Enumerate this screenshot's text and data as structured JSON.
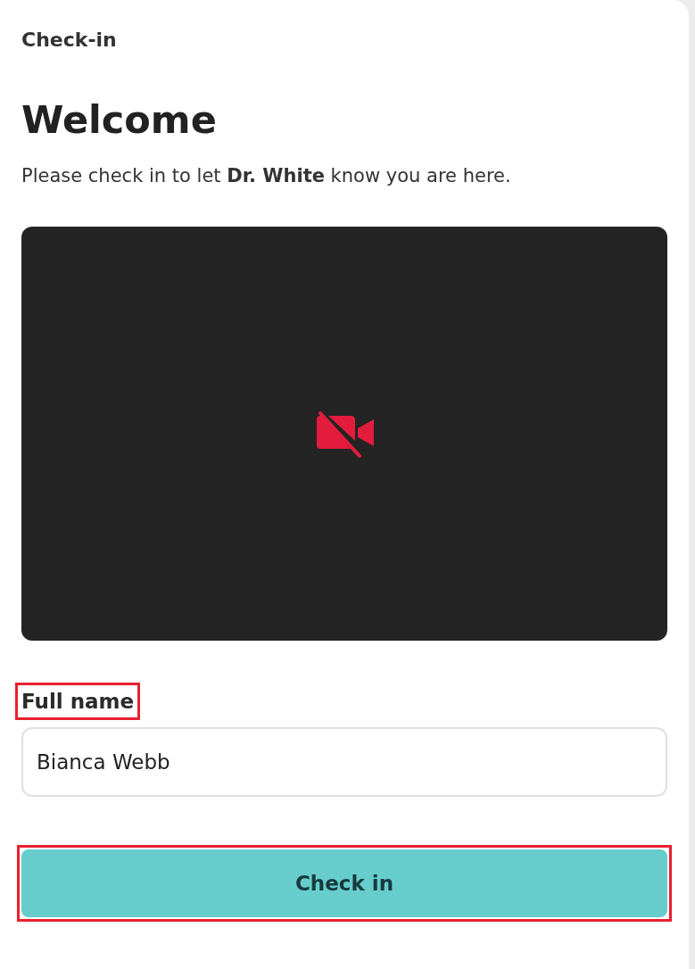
{
  "header": {
    "title": "Check-in"
  },
  "heading": "Welcome",
  "intro": "Please check in to let **Dr. White** know you are here.",
  "video": {
    "camera_on": false
  },
  "form": {
    "label": "Full name",
    "label_highlighted": true,
    "name_field": {
      "value": "Bianca Webb"
    },
    "submit": {
      "label": "Check in",
      "highlighted": true
    }
  }
}
